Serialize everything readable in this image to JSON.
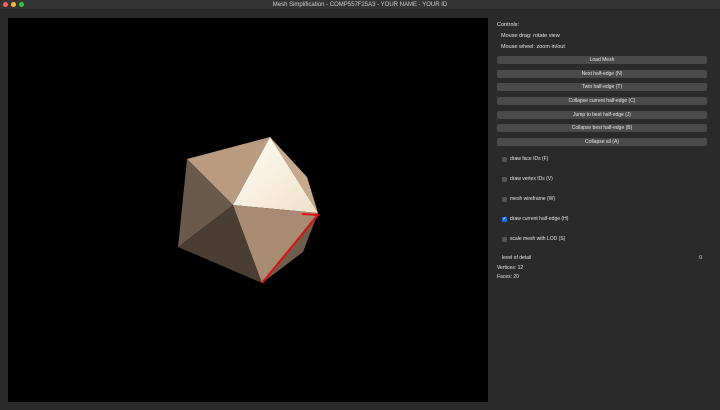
{
  "window": {
    "title": "Mesh Simplification - COMP557F25A3 - YOUR NAME - YOUR ID"
  },
  "controls": {
    "heading": "Controls:",
    "hint1": "Mouse drag: rotate view",
    "hint2": "Mouse wheel: zoom in/out"
  },
  "buttons": [
    "Load Mesh",
    "Next half-edge (N)",
    "Twin half-edge (T)",
    "Collapse current half-edge (C)",
    "Jump to best half-edge (J)",
    "Collapse best half-edge (B)",
    "Collapse all (A)"
  ],
  "checkboxes": [
    {
      "label": "draw face IDs (F)",
      "checked": false
    },
    {
      "label": "draw vertex IDs (V)",
      "checked": false
    },
    {
      "label": "mesh wireframe (W)",
      "checked": false
    },
    {
      "label": "draw current half-edge (H)",
      "checked": true
    },
    {
      "label": "scale mesh with LOD (S)",
      "checked": false
    }
  ],
  "lod": {
    "label": "level of detail",
    "value": "0"
  },
  "stats": {
    "vertices": "Vertices: 12",
    "faces": "Faces: 20"
  },
  "colors": {
    "edge": "#e01010",
    "check": "#1a6fe8"
  }
}
